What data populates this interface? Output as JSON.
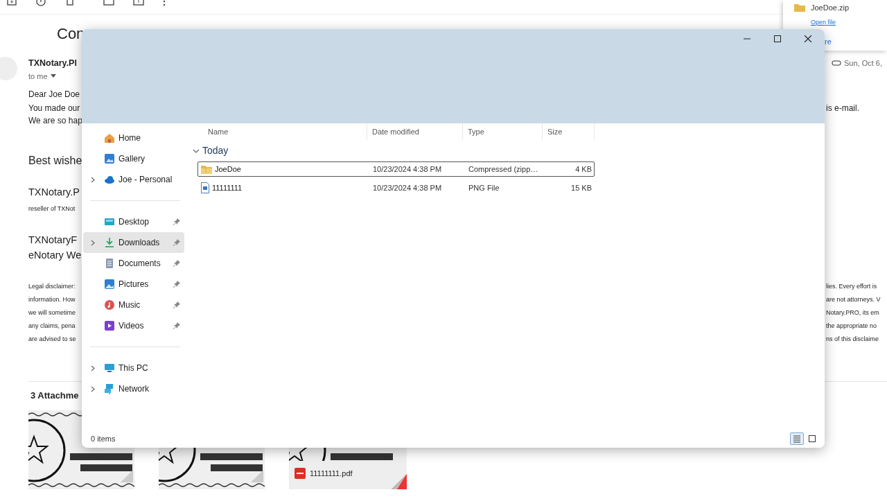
{
  "email": {
    "subject": "Con",
    "sender": "TXNotary.Pl",
    "recipient": "to me",
    "date": "Sun, Oct 6,",
    "body": [
      {
        "left": "Dear Joe Doe"
      },
      {
        "left": "You made our",
        "right": "is e-mail."
      },
      {
        "left": "We are so hap"
      }
    ],
    "signoff": "Best wishe",
    "signature": "TXNotary.P",
    "reseller": "reseller of TXNot",
    "links": [
      "TXNotaryF",
      "eNotary We"
    ],
    "disclaimer": [
      {
        "left": "Legal disclaimer:",
        "right": "lies. Every effort is"
      },
      {
        "left": "information. How",
        "right": "are not attorneys. V"
      },
      {
        "left": "we will sometime",
        "right": "Notary.PRO, its em"
      },
      {
        "left": "any claims, pena",
        "right": "the appropriate no"
      },
      {
        "left": "are advised to se",
        "right": "ns of this disclaime"
      }
    ],
    "attachments_heading": "3 Attachme",
    "attachments": [
      {
        "kind": "picture"
      },
      {
        "kind": "picture"
      },
      {
        "kind": "file",
        "name": "11111111.pdf"
      }
    ]
  },
  "download_popup": {
    "file": "JoeDoe.zip",
    "action": "Open file",
    "more": "re"
  },
  "explorer": {
    "sidebar": [
      {
        "items": [
          {
            "label": "Home",
            "kind": "home",
            "expandable": false,
            "pinned": false,
            "selected": false
          },
          {
            "label": "Gallery",
            "kind": "gallery",
            "expandable": false,
            "pinned": false,
            "selected": false
          },
          {
            "label": "Joe - Personal",
            "kind": "cloud",
            "expandable": true,
            "pinned": false,
            "selected": false
          }
        ]
      },
      {
        "items": [
          {
            "label": "Desktop",
            "kind": "desktop",
            "expandable": false,
            "pinned": true,
            "selected": false
          },
          {
            "label": "Downloads",
            "kind": "downloads",
            "expandable": true,
            "pinned": true,
            "selected": true
          },
          {
            "label": "Documents",
            "kind": "documents",
            "expandable": false,
            "pinned": true,
            "selected": false
          },
          {
            "label": "Pictures",
            "kind": "pictures",
            "expandable": false,
            "pinned": true,
            "selected": false
          },
          {
            "label": "Music",
            "kind": "music",
            "expandable": false,
            "pinned": true,
            "selected": false
          },
          {
            "label": "Videos",
            "kind": "videos",
            "expandable": false,
            "pinned": true,
            "selected": false
          }
        ]
      },
      {
        "items": [
          {
            "label": "This PC",
            "kind": "pc",
            "expandable": true,
            "pinned": false,
            "selected": false
          },
          {
            "label": "Network",
            "kind": "network",
            "expandable": true,
            "pinned": false,
            "selected": false
          }
        ]
      }
    ],
    "columns": [
      "Name",
      "Date modified",
      "Type",
      "Size"
    ],
    "groups": [
      {
        "label": "Today",
        "expanded": true,
        "rows": [
          {
            "name": "JoeDoe",
            "kind": "zip",
            "date": "10/23/2024 4:38 PM",
            "type": "Compressed (zipp…",
            "size": "4 KB",
            "selected": true
          },
          {
            "name": "11111111",
            "kind": "png",
            "date": "10/23/2024 4:38 PM",
            "type": "PNG File",
            "size": "15 KB",
            "selected": false
          }
        ]
      }
    ],
    "status": "0 items",
    "views": [
      {
        "kind": "details",
        "selected": true
      },
      {
        "kind": "tiles",
        "selected": false
      }
    ]
  }
}
